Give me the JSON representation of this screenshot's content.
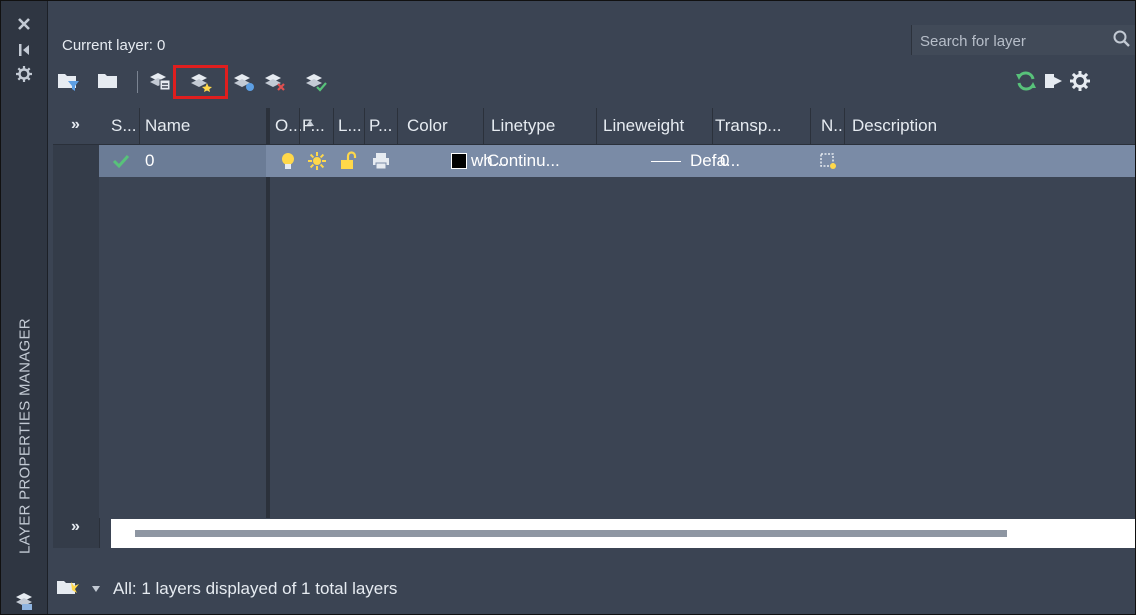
{
  "window": {
    "side_title": "LAYER PROPERTIES MANAGER",
    "current_layer": "Current layer: 0"
  },
  "search": {
    "placeholder": "Search for layer"
  },
  "toolbar": {
    "left_icons": [
      "new-property-filter-icon",
      "new-group-filter-icon",
      "layer-states-manager-icon",
      "new-layer-icon",
      "new-layer-vp-frozen-icon",
      "delete-layer-icon",
      "set-current-icon"
    ],
    "right_icons": [
      "refresh-icon",
      "layer-settings-arrow-icon",
      "settings-icon"
    ],
    "highlighted": "new-layer-icon",
    "highlight_color": "#e01e1e"
  },
  "table": {
    "expand_label": "»",
    "columns": [
      "S...",
      "Name",
      "O...",
      "F...",
      "L...",
      "P...",
      "Color",
      "Linetype",
      "Lineweight",
      "Transp...",
      "N..",
      "Description"
    ],
    "rows": [
      {
        "status": "✓",
        "name": "0",
        "color_name": "wh...",
        "color_swatch": "#000000",
        "linetype": "Continu...",
        "lineweight": "Defa...",
        "transparency": "0",
        "description": ""
      }
    ]
  },
  "status_bar": {
    "text": "All: 1 layers displayed of 1 total layers"
  },
  "colors": {
    "panel_bg": "#3b4453",
    "selected_row": "#7a8ba6",
    "check_green": "#58c27a",
    "bulb_yellow": "#ffd84a"
  }
}
